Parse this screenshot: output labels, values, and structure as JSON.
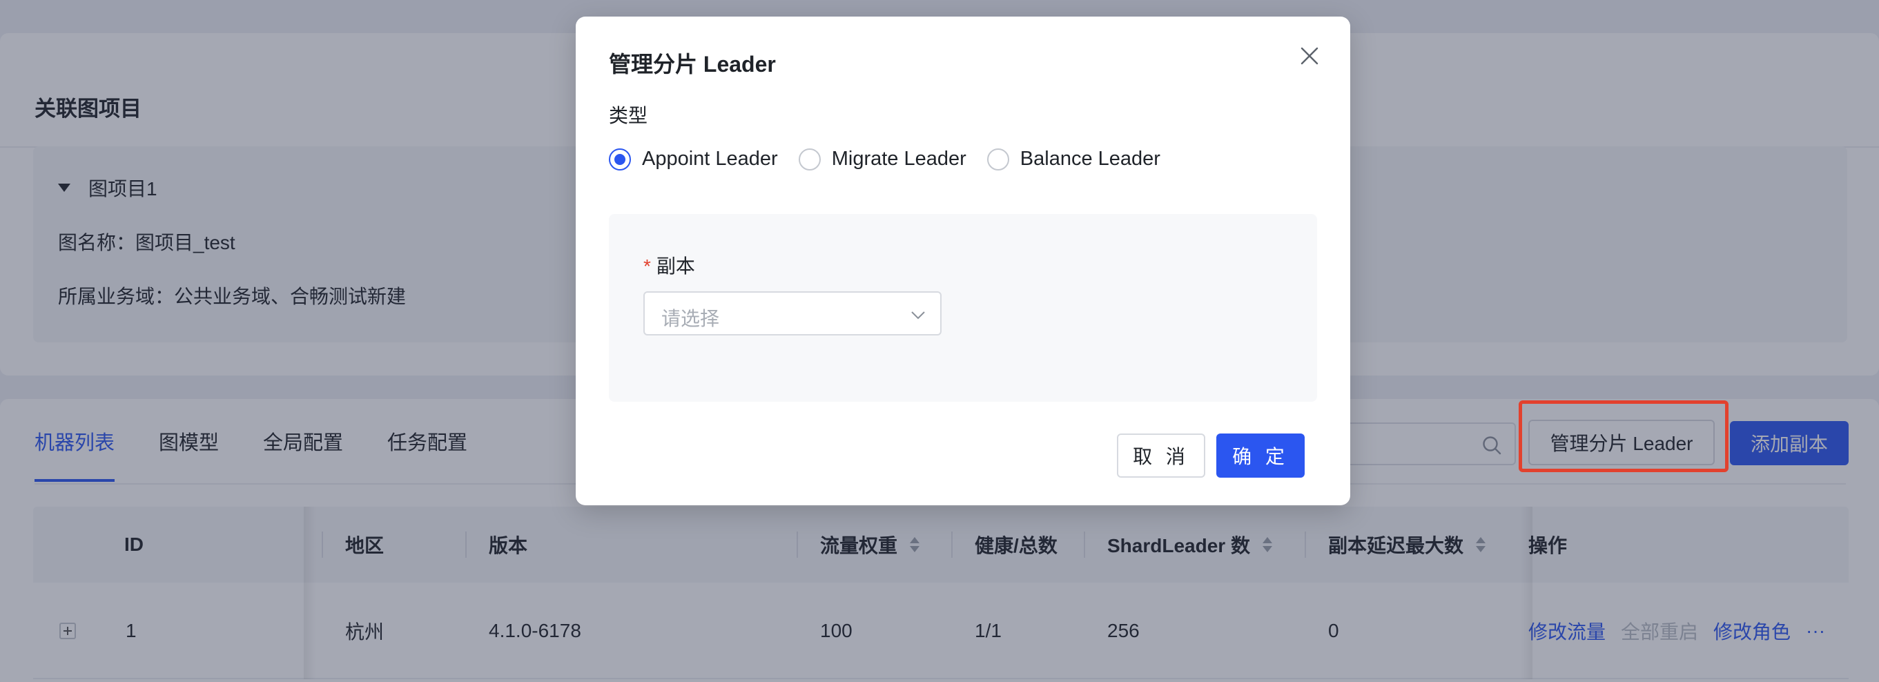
{
  "top_card": {
    "title": "关联图项目",
    "project": {
      "name": "图项目1",
      "graph_name": "图名称：图项目_test",
      "business_domain": "所属业务域：公共业务域、合畅测试新建"
    }
  },
  "tabs": [
    {
      "label": "机器列表",
      "active": true
    },
    {
      "label": "图模型",
      "active": false
    },
    {
      "label": "全局配置",
      "active": false
    },
    {
      "label": "任务配置",
      "active": false
    }
  ],
  "toolbar": {
    "search_placeholder": "",
    "manage_leader_label": "管理分片 Leader",
    "add_replica_label": "添加副本"
  },
  "table": {
    "columns": [
      "ID",
      "地区",
      "版本",
      "流量权重",
      "健康/总数",
      "ShardLeader 数",
      "副本延迟最大数",
      "操作"
    ],
    "rows": [
      {
        "id": "1",
        "region": "杭州",
        "version": "4.1.0-6178",
        "weight": "100",
        "health": "1/1",
        "shard_leader": "256",
        "replica_delay": "0",
        "actions": [
          "修改流量",
          "全部重启",
          "修改角色",
          "···"
        ]
      }
    ]
  },
  "modal": {
    "title": "管理分片 Leader",
    "type_label": "类型",
    "radio_options": [
      {
        "label": "Appoint Leader",
        "checked": true
      },
      {
        "label": "Migrate Leader",
        "checked": false
      },
      {
        "label": "Balance Leader",
        "checked": false
      }
    ],
    "replica_label": "副本",
    "required_mark": "*",
    "replica_placeholder": "请选择",
    "cancel_label": "取 消",
    "ok_label": "确 定"
  },
  "colors": {
    "primary": "#2b56f0",
    "highlight_border": "#e2412e",
    "overlay": "rgba(40,48,74,0.42)"
  },
  "icons": [
    "caret-down-icon",
    "search-icon",
    "sort-icon",
    "expand-icon",
    "close-icon",
    "chevron-down-icon"
  ]
}
